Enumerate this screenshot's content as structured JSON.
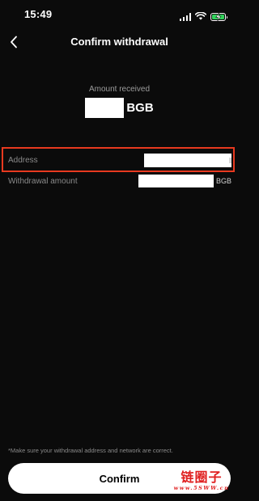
{
  "status_bar": {
    "time": "15:49",
    "icons": [
      "signal-icon",
      "wifi-icon",
      "battery-charging-icon"
    ]
  },
  "header": {
    "title": "Confirm withdrawal",
    "back_icon": "chevron-left-icon"
  },
  "amount": {
    "label": "Amount received",
    "value_redacted": true,
    "unit": "BGB"
  },
  "details": {
    "address": {
      "label": "Address",
      "value_redacted": true,
      "highlighted": true
    },
    "withdrawal_amount": {
      "label": "Withdrawal amount",
      "value_redacted": true,
      "unit": "BGB"
    }
  },
  "footer": {
    "note": "*Make sure your withdrawal address and network are correct.",
    "confirm_label": "Confirm"
  },
  "watermark": {
    "main": "链圈子",
    "sub": "www.5SWW.cn"
  },
  "colors": {
    "background": "#0b0b0b",
    "highlight_border": "#e8391f",
    "button_bg": "#ffffff",
    "battery_fill": "#33d35c",
    "watermark": "#e02020"
  }
}
